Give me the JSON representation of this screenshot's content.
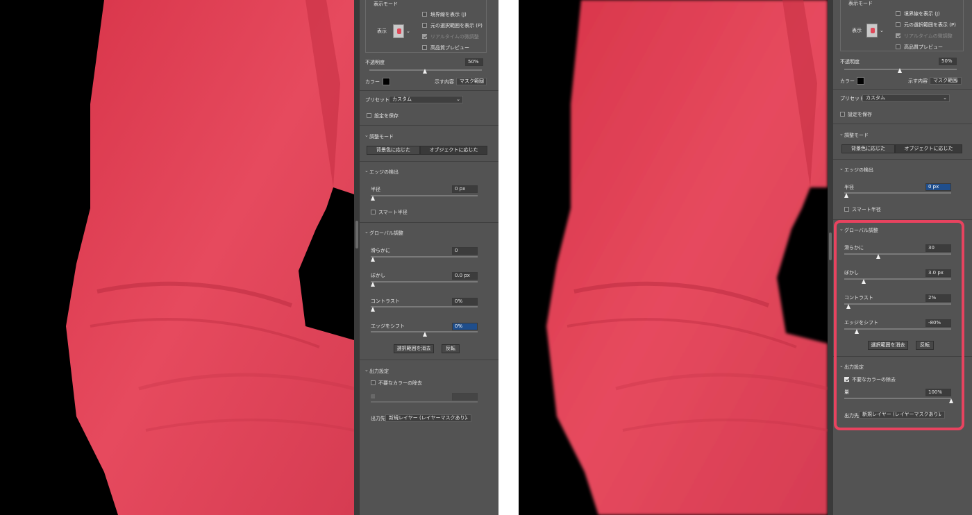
{
  "left_panel": {
    "view_mode": {
      "title": "表示モード",
      "view_label": "表示",
      "options": [
        {
          "label": "境界線を表示 (J)",
          "checked": false,
          "disabled": false
        },
        {
          "label": "元の選択範囲を表示 (P)",
          "checked": false,
          "disabled": false
        },
        {
          "label": "リアルタイムの微調整",
          "checked": true,
          "disabled": true
        },
        {
          "label": "高品質プレビュー",
          "checked": false,
          "disabled": false
        }
      ]
    },
    "opacity": {
      "label": "不透明度",
      "value": "50%",
      "fraction": 0.5
    },
    "color": {
      "label": "カラー",
      "swatch": "#000000",
      "show_label": "示す内容",
      "show_value": "マスク範囲"
    },
    "preset": {
      "label": "プリセット",
      "value": "カスタム",
      "save_label": "設定を保存",
      "save_checked": false
    },
    "adjust_mode": {
      "title": "調整モード",
      "buttons": [
        "背景色に応じた",
        "オブジェクトに応じた"
      ]
    },
    "edge_detection": {
      "title": "エッジの検出",
      "radius_label": "半径",
      "radius_value": "0 px",
      "radius_fraction": 0.0,
      "smart_label": "スマート半径",
      "smart_checked": false
    },
    "global": {
      "title": "グローバル調整",
      "smooth_label": "滑らかに",
      "smooth_value": "0",
      "smooth_fraction": 0.0,
      "feather_label": "ぼかし",
      "feather_value": "0.0 px",
      "feather_fraction": 0.0,
      "contrast_label": "コントラスト",
      "contrast_value": "0%",
      "contrast_fraction": 0.0,
      "shift_label": "エッジをシフト",
      "shift_value": "0%",
      "shift_fraction": 0.5,
      "clear_button": "選択範囲を消去",
      "invert_button": "反転"
    },
    "output": {
      "title": "出力設定",
      "decontam_label": "不要なカラーの除去",
      "decontam_checked": false,
      "amount_value": "",
      "output_label": "出力先",
      "output_value": "新規レイヤー (レイヤーマスクあり)"
    }
  },
  "right_panel": {
    "view_mode": {
      "title": "表示モード",
      "view_label": "表示",
      "options": [
        {
          "label": "境界線を表示 (J)",
          "checked": false,
          "disabled": false
        },
        {
          "label": "元の選択範囲を表示 (P)",
          "checked": false,
          "disabled": false
        },
        {
          "label": "リアルタイムの微調整",
          "checked": true,
          "disabled": true
        },
        {
          "label": "高品質プレビュー",
          "checked": false,
          "disabled": false
        }
      ]
    },
    "opacity": {
      "label": "不透明度",
      "value": "50%",
      "fraction": 0.5
    },
    "color": {
      "label": "カラー",
      "swatch": "#000000",
      "show_label": "示す内容",
      "show_value": "マスク範囲"
    },
    "preset": {
      "label": "プリセット",
      "value": "カスタム",
      "save_label": "設定を保存",
      "save_checked": false
    },
    "adjust_mode": {
      "title": "調整モード",
      "buttons": [
        "背景色に応じた",
        "オブジェクトに応じた"
      ]
    },
    "edge_detection": {
      "title": "エッジの検出",
      "radius_label": "半径",
      "radius_value": "0 px",
      "radius_fraction": 0.0,
      "smart_label": "スマート半径",
      "smart_checked": false
    },
    "global": {
      "title": "グローバル調整",
      "smooth_label": "滑らかに",
      "smooth_value": "30",
      "smooth_fraction": 0.3,
      "feather_label": "ぼかし",
      "feather_value": "3.0 px",
      "feather_fraction": 0.1,
      "contrast_label": "コントラスト",
      "contrast_value": "2%",
      "contrast_fraction": 0.02,
      "shift_label": "エッジをシフト",
      "shift_value": "-80%",
      "shift_fraction": 0.1,
      "clear_button": "選択範囲を消去",
      "invert_button": "反転"
    },
    "output": {
      "title": "出力設定",
      "decontam_label": "不要なカラーの除去",
      "decontam_checked": true,
      "amount_label": "量",
      "amount_value": "100%",
      "amount_fraction": 1.0,
      "output_label": "出力先",
      "output_value": "新規レイヤー (レイヤーマスクあり)"
    }
  },
  "colors": {
    "panel": "#535353",
    "sleeve": "#e8435a",
    "highlight": "#e8435f"
  }
}
